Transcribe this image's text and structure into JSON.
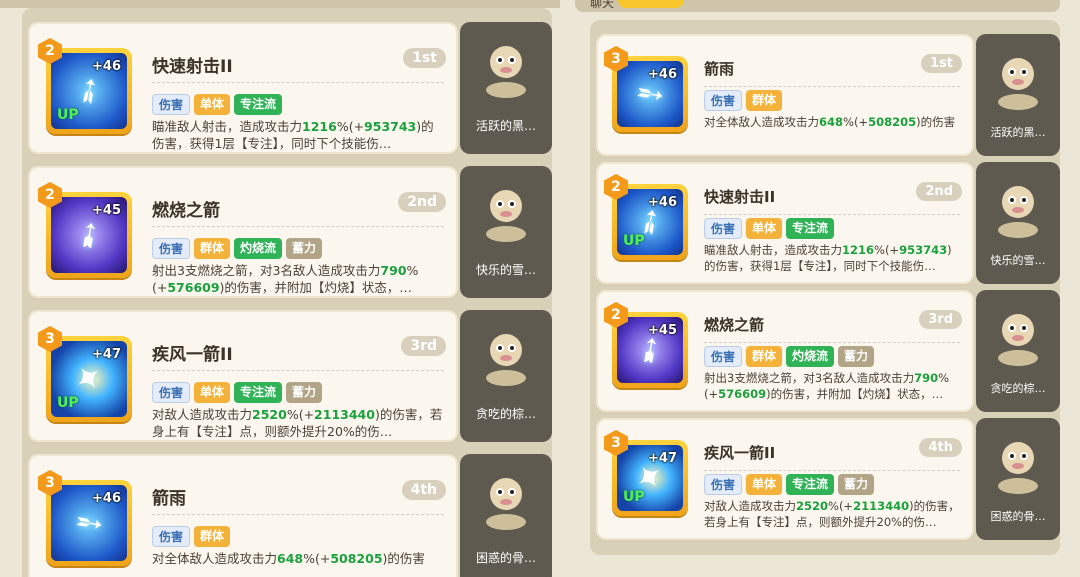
{
  "topbar": {
    "chat_label": "聊天"
  },
  "left": {
    "cards": [
      {
        "level": "2",
        "plus": "+46",
        "up": "UP",
        "icon": "arrow-shot-icon",
        "title": "快速射击II",
        "rank": "1st",
        "tags": [
          [
            "伤害",
            "t-blue"
          ],
          [
            "单体",
            "t-orange"
          ],
          [
            "专注流",
            "t-green"
          ]
        ],
        "desc_a": "瞄准敌人射击，造成攻击力",
        "n1": "1216",
        "desc_b": "%(+",
        "n2": "953743",
        "desc_c": ")的伤害，获得1层【专注】，同时下个技能伤…",
        "pet": "活跃的黑…"
      },
      {
        "level": "2",
        "plus": "+45",
        "up": "",
        "icon": "burning-arrows-icon",
        "title": "燃烧之箭",
        "rank": "2nd",
        "tags": [
          [
            "伤害",
            "t-blue"
          ],
          [
            "群体",
            "t-orange"
          ],
          [
            "灼烧流",
            "t-green"
          ],
          [
            "蓄力",
            "t-gray"
          ]
        ],
        "desc_a": "射出3支燃烧之箭，对3名敌人造成攻击力",
        "n1": "790",
        "desc_b": "%(+",
        "n2": "576609",
        "desc_c": ")的伤害，并附加【灼烧】状态，…",
        "pet": "快乐的雪…"
      },
      {
        "level": "3",
        "plus": "+47",
        "up": "UP",
        "icon": "wind-arrow-icon",
        "title": "疾风一箭II",
        "rank": "3rd",
        "tags": [
          [
            "伤害",
            "t-blue"
          ],
          [
            "单体",
            "t-orange"
          ],
          [
            "专注流",
            "t-green"
          ],
          [
            "蓄力",
            "t-gray"
          ]
        ],
        "desc_a": "对敌人造成攻击力",
        "n1": "2520",
        "desc_b": "%(+",
        "n2": "2113440",
        "desc_c": ")的伤害，若身上有【专注】点，则额外提升20%的伤…",
        "pet": "贪吃的棕…"
      },
      {
        "level": "3",
        "plus": "+46",
        "up": "",
        "icon": "arrow-rain-icon",
        "title": "箭雨",
        "rank": "4th",
        "tags": [
          [
            "伤害",
            "t-blue"
          ],
          [
            "群体",
            "t-orange"
          ]
        ],
        "desc_a": "对全体敌人造成攻击力",
        "n1": "648",
        "desc_b": "%(+",
        "n2": "508205",
        "desc_c": ")的伤害",
        "pet": "困惑的骨…"
      }
    ]
  },
  "right": {
    "cards": [
      {
        "level": "3",
        "plus": "+46",
        "up": "",
        "icon": "arrow-rain-icon",
        "title": "箭雨",
        "rank": "1st",
        "tags": [
          [
            "伤害",
            "t-blue"
          ],
          [
            "群体",
            "t-orange"
          ]
        ],
        "desc_a": "对全体敌人造成攻击力",
        "n1": "648",
        "desc_b": "%(+",
        "n2": "508205",
        "desc_c": ")的伤害",
        "pet": "活跃的黑…"
      },
      {
        "level": "2",
        "plus": "+46",
        "up": "UP",
        "icon": "arrow-shot-icon",
        "title": "快速射击II",
        "rank": "2nd",
        "tags": [
          [
            "伤害",
            "t-blue"
          ],
          [
            "单体",
            "t-orange"
          ],
          [
            "专注流",
            "t-green"
          ]
        ],
        "desc_a": "瞄准敌人射击，造成攻击力",
        "n1": "1216",
        "desc_b": "%(+",
        "n2": "953743",
        "desc_c": ")的伤害，获得1层【专注】，同时下个技能伤…",
        "pet": "快乐的雪…"
      },
      {
        "level": "2",
        "plus": "+45",
        "up": "",
        "icon": "burning-arrows-icon",
        "title": "燃烧之箭",
        "rank": "3rd",
        "tags": [
          [
            "伤害",
            "t-blue"
          ],
          [
            "群体",
            "t-orange"
          ],
          [
            "灼烧流",
            "t-green"
          ],
          [
            "蓄力",
            "t-gray"
          ]
        ],
        "desc_a": "射出3支燃烧之箭，对3名敌人造成攻击力",
        "n1": "790",
        "desc_b": "%(+",
        "n2": "576609",
        "desc_c": ")的伤害，并附加【灼烧】状态，…",
        "pet": "贪吃的棕…"
      },
      {
        "level": "3",
        "plus": "+47",
        "up": "UP",
        "icon": "wind-arrow-icon",
        "title": "疾风一箭II",
        "rank": "4th",
        "tags": [
          [
            "伤害",
            "t-blue"
          ],
          [
            "单体",
            "t-orange"
          ],
          [
            "专注流",
            "t-green"
          ],
          [
            "蓄力",
            "t-gray"
          ]
        ],
        "desc_a": "对敌人造成攻击力",
        "n1": "2520",
        "desc_b": "%(+",
        "n2": "2113440",
        "desc_c": ")的伤害，若身上有【专注】点，则额外提升20%的伤…",
        "pet": "困惑的骨…"
      }
    ]
  }
}
